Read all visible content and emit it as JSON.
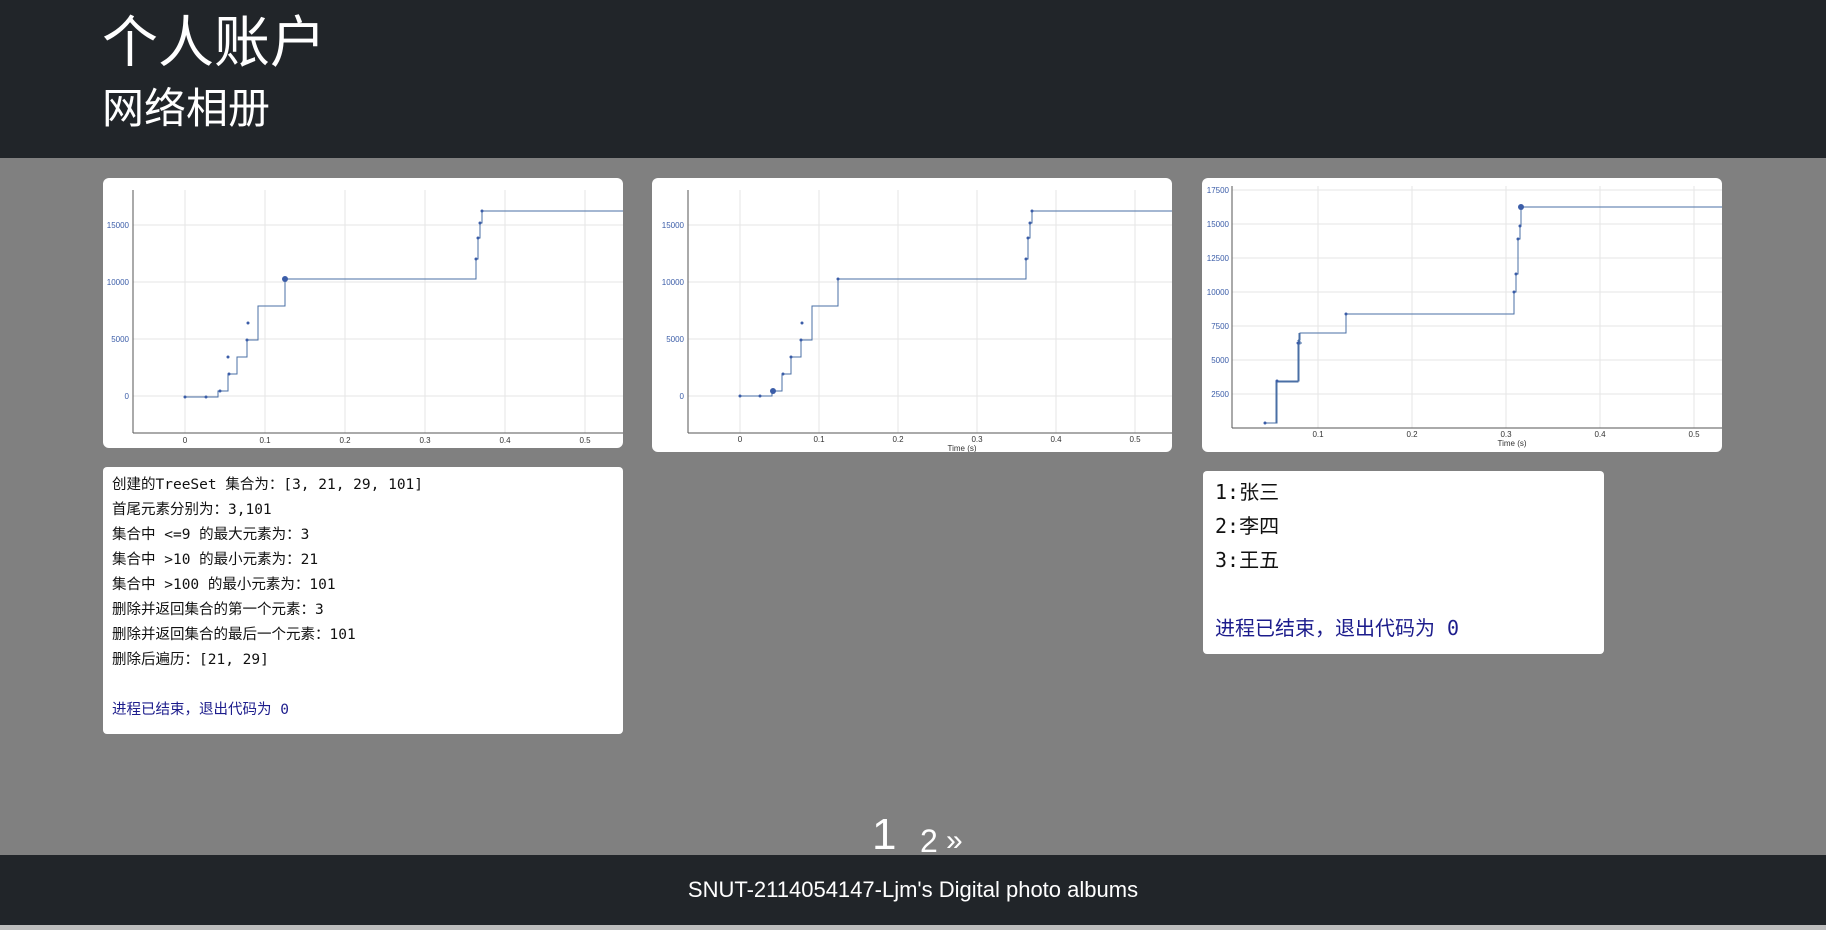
{
  "header": {
    "title": "个人账户",
    "subtitle": "网络相册"
  },
  "photos": [
    {
      "name": "plot-1",
      "yticks": [
        "15000",
        "10000",
        "5000",
        "0"
      ],
      "xticks": [
        "0",
        "0.1",
        "0.2",
        "0.3",
        "0.4",
        "0.5"
      ]
    },
    {
      "name": "plot-2",
      "yticks": [
        "15000",
        "10000",
        "5000",
        "0"
      ],
      "xticks": [
        "0",
        "0.1",
        "0.2",
        "0.3",
        "0.4",
        "0.5"
      ],
      "xlabel": "Time (s)"
    },
    {
      "name": "plot-3",
      "yticks": [
        "17500",
        "15000",
        "12500",
        "10000",
        "7500",
        "5000",
        "2500"
      ],
      "xticks": [
        "0.1",
        "0.2",
        "0.3",
        "0.4",
        "0.5"
      ],
      "xlabel": "Time (s)"
    }
  ],
  "console1": {
    "lines": [
      "创建的TreeSet 集合为：[3, 21, 29, 101]",
      "首尾元素分别为：3,101",
      "集合中 <=9 的最大元素为：3",
      "集合中 >10 的最小元素为：21",
      "集合中 >100 的最小元素为：101",
      "删除并返回集合的第一个元素：3",
      "删除并返回集合的最后一个元素：101",
      "删除后遍历：[21, 29]"
    ],
    "exit": "进程已结束，退出代码为 0"
  },
  "console2": {
    "lines": [
      "1:张三",
      "2:李四",
      "3:王五"
    ],
    "exit": "进程已结束，退出代码为 0"
  },
  "pagination": {
    "current": "1",
    "next_page": "2",
    "next_arrow": "»"
  },
  "footer": {
    "text": "SNUT-2114054147-Ljm's Digital photo albums"
  }
}
